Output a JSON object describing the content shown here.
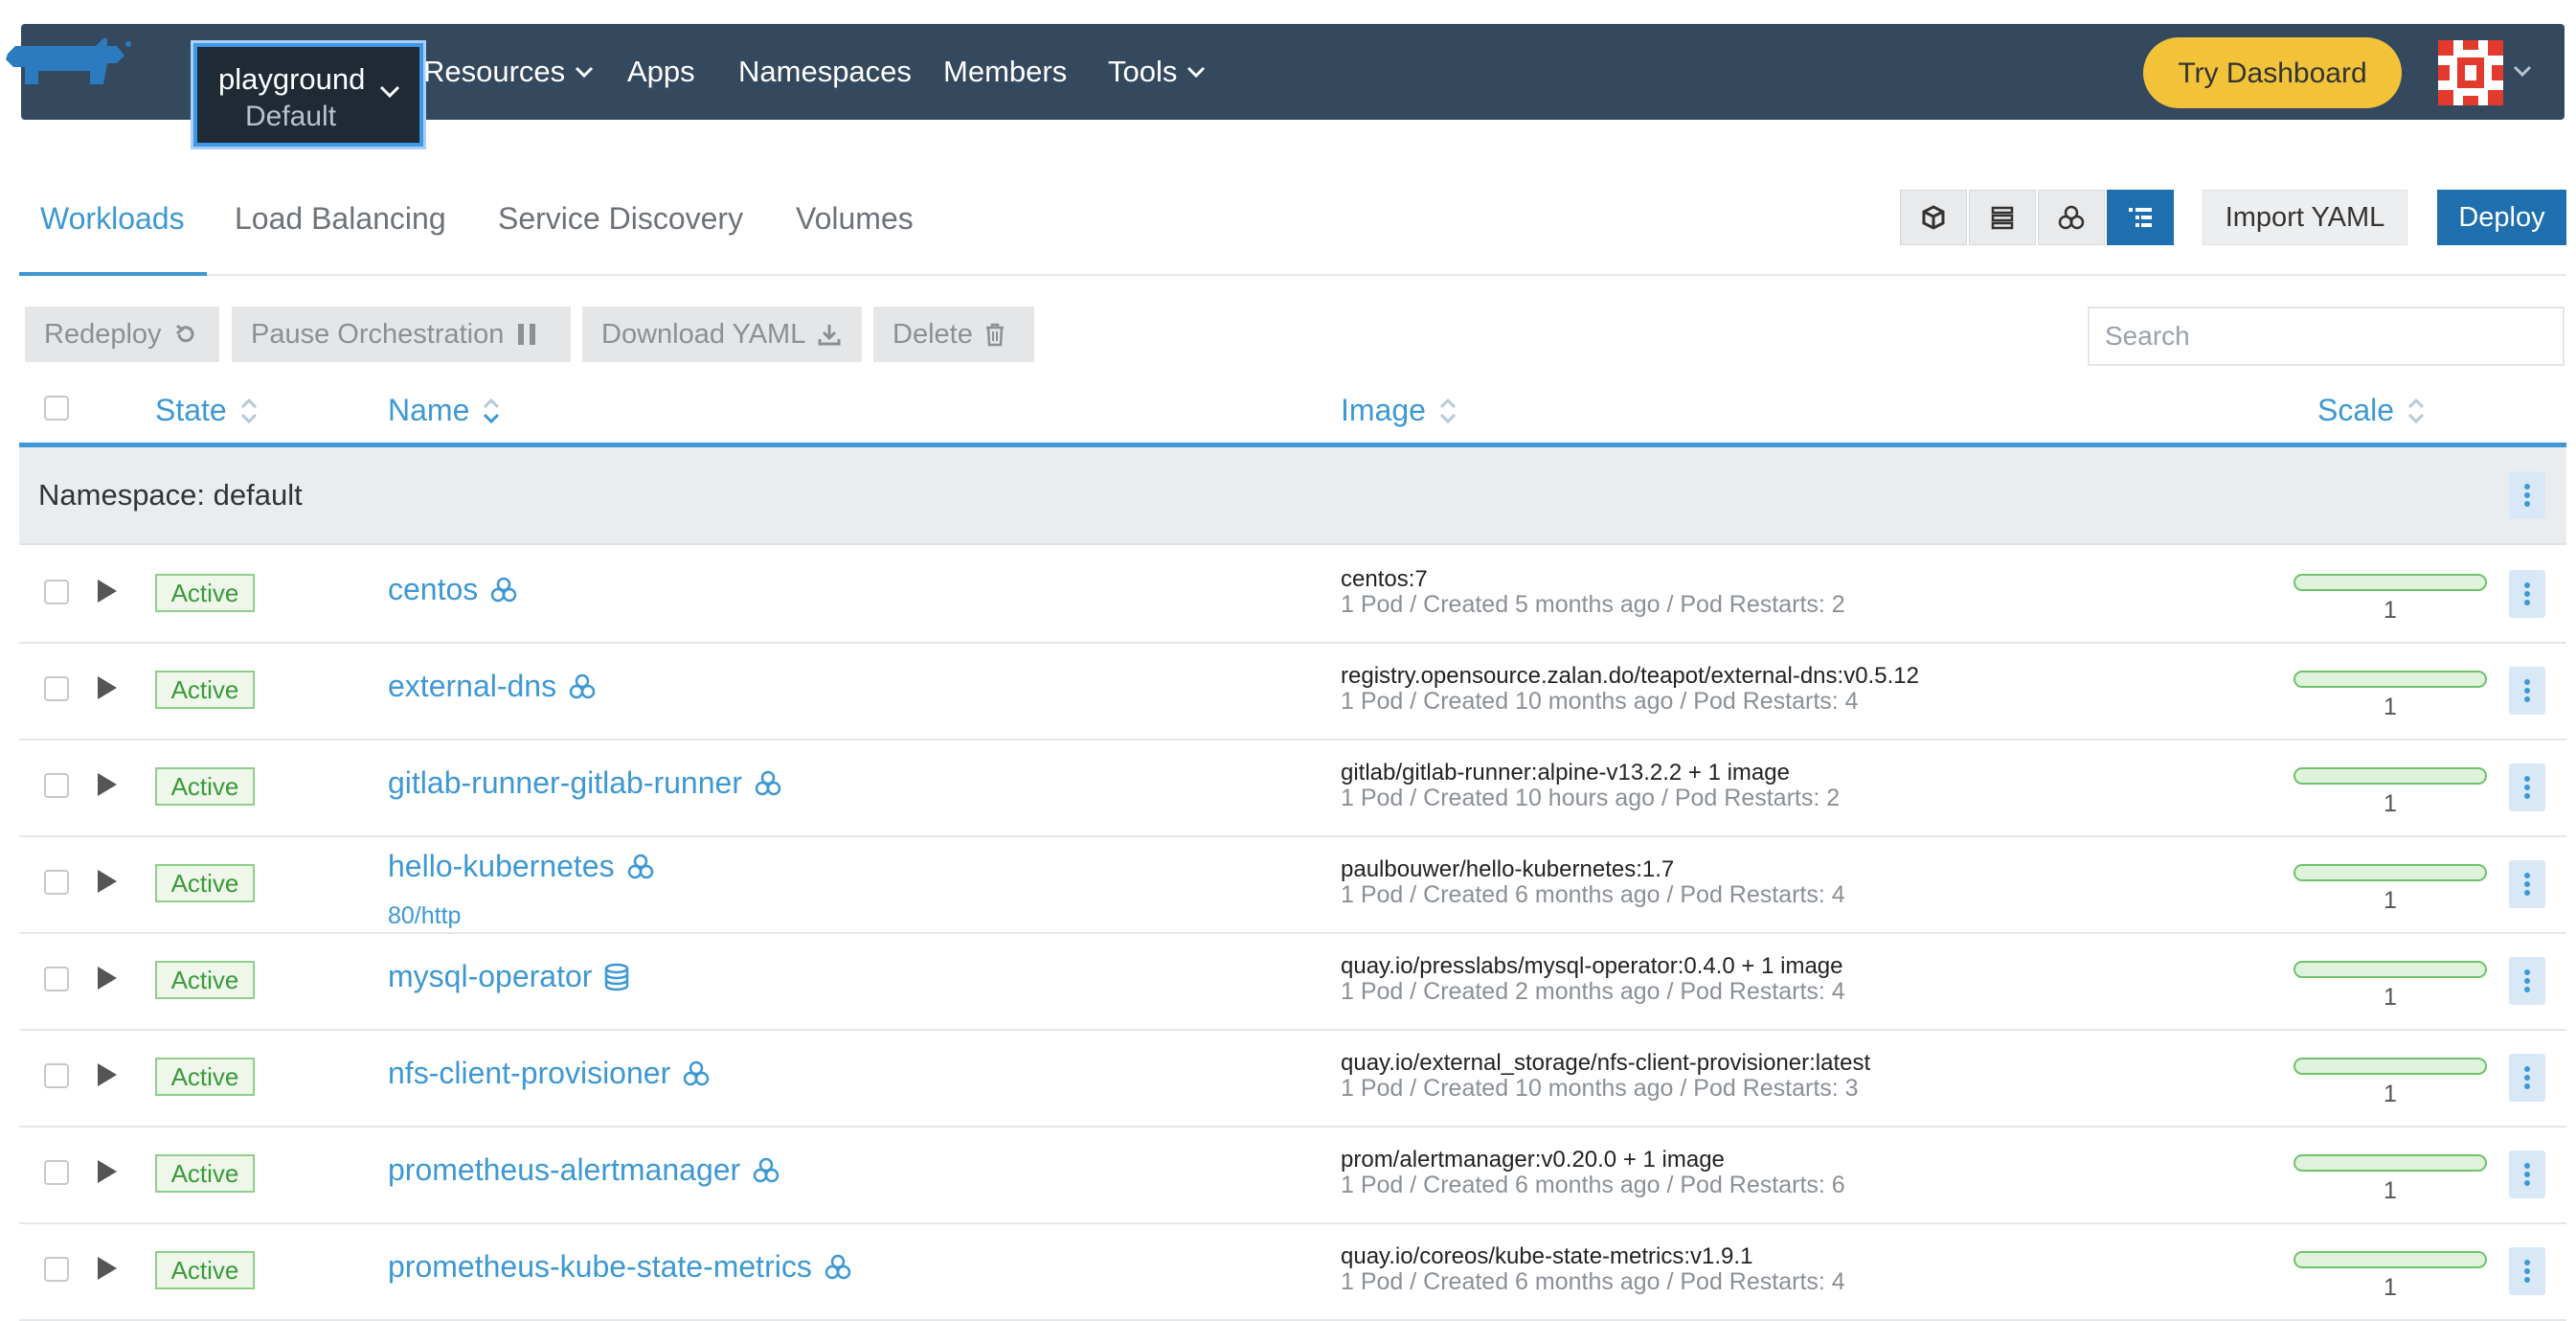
{
  "header": {
    "project": {
      "name": "playground",
      "cluster": "Default"
    },
    "nav": [
      {
        "label": "Resources",
        "has_dropdown": true
      },
      {
        "label": "Apps",
        "has_dropdown": false
      },
      {
        "label": "Namespaces",
        "has_dropdown": false
      },
      {
        "label": "Members",
        "has_dropdown": false
      },
      {
        "label": "Tools",
        "has_dropdown": true
      }
    ],
    "try_dashboard_label": "Try Dashboard"
  },
  "tabs": [
    "Workloads",
    "Load Balancing",
    "Service Discovery",
    "Volumes"
  ],
  "view_switcher": [
    "node-view-icon",
    "list-view-icon",
    "group-view-icon",
    "tree-view-icon"
  ],
  "actions": {
    "import_yaml": "Import YAML",
    "deploy": "Deploy",
    "redeploy": "Redeploy",
    "pause": "Pause Orchestration",
    "download_yaml": "Download YAML",
    "delete": "Delete"
  },
  "search": {
    "placeholder": "Search",
    "value": ""
  },
  "table": {
    "columns": {
      "state": "State",
      "name": "Name",
      "image": "Image",
      "scale": "Scale"
    },
    "group_label": "Namespace: default",
    "rows": [
      {
        "state": "Active",
        "name": "centos",
        "icon": "deployment-icon",
        "image": "centos:7",
        "meta": "1 Pod / Created 5 months ago / Pod Restarts: 2",
        "scale": "1"
      },
      {
        "state": "Active",
        "name": "external-dns",
        "icon": "deployment-icon",
        "image": "registry.opensource.zalan.do/teapot/external-dns:v0.5.12",
        "meta": "1 Pod / Created 10 months ago / Pod Restarts: 4",
        "scale": "1"
      },
      {
        "state": "Active",
        "name": "gitlab-runner-gitlab-runner",
        "icon": "deployment-icon",
        "image": "gitlab/gitlab-runner:alpine-v13.2.2 + 1 image",
        "meta": "1 Pod / Created 10 hours ago / Pod Restarts: 2",
        "scale": "1"
      },
      {
        "state": "Active",
        "name": "hello-kubernetes",
        "icon": "deployment-icon",
        "port": "80/http",
        "image": "paulbouwer/hello-kubernetes:1.7",
        "meta": "1 Pod / Created 6 months ago / Pod Restarts: 4",
        "scale": "1"
      },
      {
        "state": "Active",
        "name": "mysql-operator",
        "icon": "statefulset-icon",
        "image": "quay.io/presslabs/mysql-operator:0.4.0 + 1 image",
        "meta": "1 Pod / Created 2 months ago / Pod Restarts: 4",
        "scale": "1"
      },
      {
        "state": "Active",
        "name": "nfs-client-provisioner",
        "icon": "deployment-icon",
        "image": "quay.io/external_storage/nfs-client-provisioner:latest",
        "meta": "1 Pod / Created 10 months ago / Pod Restarts: 3",
        "scale": "1"
      },
      {
        "state": "Active",
        "name": "prometheus-alertmanager",
        "icon": "deployment-icon",
        "image": "prom/alertmanager:v0.20.0 + 1 image",
        "meta": "1 Pod / Created 6 months ago / Pod Restarts: 6",
        "scale": "1"
      },
      {
        "state": "Active",
        "name": "prometheus-kube-state-metrics",
        "icon": "deployment-icon",
        "image": "quay.io/coreos/kube-state-metrics:v1.9.1",
        "meta": "1 Pod / Created 6 months ago / Pod Restarts: 4",
        "scale": "1"
      }
    ]
  },
  "colors": {
    "header_bg": "#34495e",
    "accent": "#3d98d3",
    "try_dashboard": "#f2c338",
    "deploy": "#1f6fae",
    "active_badge": "#8fcf8a"
  }
}
